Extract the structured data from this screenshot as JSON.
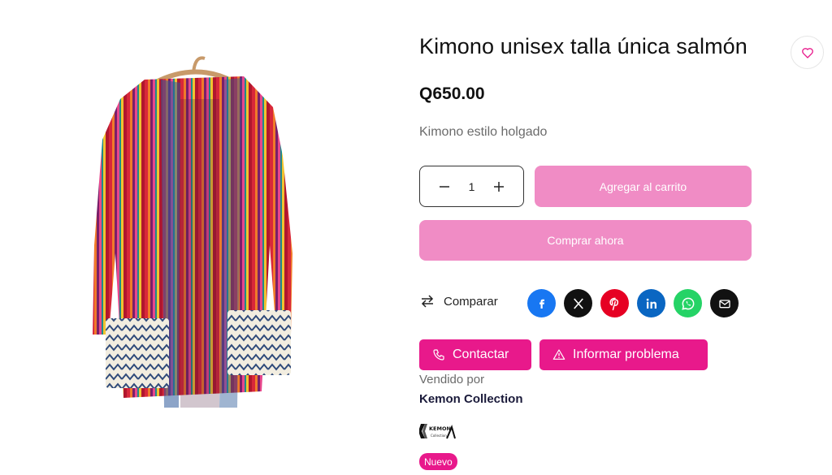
{
  "product": {
    "title": "Kimono unisex talla única salmón",
    "price": "Q650.00",
    "description": "Kimono estilo holgado",
    "image_icon": "striped-kimono-jacket-photo"
  },
  "quantity": {
    "value": "1",
    "decrease_icon": "minus-icon",
    "increase_icon": "plus-icon"
  },
  "buttons": {
    "add_to_cart": "Agregar al carrito",
    "buy_now": "Comprar ahora",
    "compare": "Comparar",
    "contact": "Contactar",
    "report": "Informar problema"
  },
  "share": [
    {
      "name": "facebook",
      "color": "#1877f2"
    },
    {
      "name": "x",
      "color": "#111111"
    },
    {
      "name": "pinterest",
      "color": "#e60023"
    },
    {
      "name": "linkedin",
      "color": "#0a66c2"
    },
    {
      "name": "whatsapp",
      "color": "#25d366"
    },
    {
      "name": "email",
      "color": "#111111"
    }
  ],
  "seller": {
    "sold_by_label": "Vendido por",
    "name": "Kemon Collection",
    "logo_text": "KEMON",
    "logo_subtext": "Collection"
  },
  "badge": "Nuevo",
  "colors": {
    "accent": "#e8198b",
    "accent_light": "#f08cc5"
  }
}
